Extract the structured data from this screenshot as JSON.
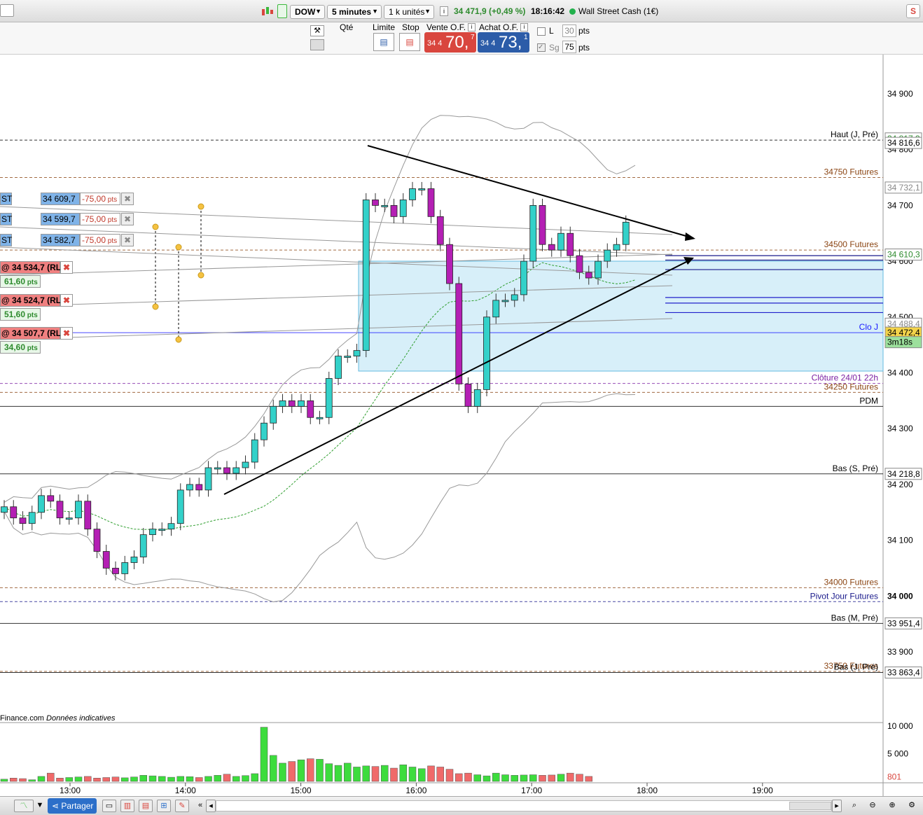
{
  "toolbar": {
    "instrument": "DOW",
    "timeframe": "5 minutes",
    "units": "1 k unités",
    "quote": "34 471,9 (+0,49 %)",
    "time": "18:16:42",
    "market_name": "Wall Street Cash (1€)",
    "status_color": "#22b14c"
  },
  "order": {
    "qty_label": "Qté",
    "limit_label": "Limite",
    "stop_label": "Stop",
    "sell_label": "Vente O.F.",
    "buy_label": "Achat O.F.",
    "sell_prefix": "34 4",
    "sell_big": "70,",
    "sell_sup": "7",
    "buy_prefix": "34 4",
    "buy_big": "73,",
    "buy_sup": "1",
    "l_label": "L",
    "l_value": "30",
    "pts1": "pts",
    "sg_label": "Sg",
    "sg_value": "75",
    "pts2": "pts",
    "sell_color": "#d9463e",
    "buy_color": "#2c5ca8"
  },
  "price_axis": {
    "ticks": [
      "34 900",
      "34 800",
      "34 700",
      "34 600",
      "34 500",
      "34 400",
      "34 300",
      "34 200",
      "34 100",
      "34 000",
      "33 900"
    ],
    "boxes": [
      {
        "text": "34 817,3",
        "color": "#2e8b2e"
      },
      {
        "text": "34 816,6",
        "color": "#000"
      },
      {
        "text": "34 732,1",
        "color": "#888"
      },
      {
        "text": "34 610,3",
        "color": "#2e8b2e"
      },
      {
        "text": "34 488,4",
        "color": "#888"
      },
      {
        "text": "34 472,4",
        "color": "#000"
      },
      {
        "text": "3m18s",
        "color": "#000"
      },
      {
        "text": "34 218,8",
        "color": "#000"
      },
      {
        "text": "33 951,4",
        "color": "#000"
      },
      {
        "text": "33 863,4",
        "color": "#000"
      }
    ]
  },
  "levels": [
    {
      "label": "34750 Futures",
      "color": "#8b4513"
    },
    {
      "label": "Haut (J, Pré)",
      "color": "#000"
    },
    {
      "label": "34500 Futures",
      "color": "#8b4513"
    },
    {
      "label": "Clo J",
      "color": "#1a1aff"
    },
    {
      "label": "Clôture 24/01 22h",
      "color": "#7b1fa2"
    },
    {
      "label": "34250 Futures",
      "color": "#8b4513"
    },
    {
      "label": "PDM",
      "color": "#000"
    },
    {
      "label": "Bas (S, Pré)",
      "color": "#000"
    },
    {
      "label": "34000 Futures",
      "color": "#8b4513"
    },
    {
      "label": "Pivot Jour Futures",
      "color": "#1a1a8b"
    },
    {
      "label": "Bas (M, Pré)",
      "color": "#000"
    },
    {
      "label": "33750 Futures",
      "color": "#8b4513"
    },
    {
      "label": "Bas (J, Pré)",
      "color": "#000"
    }
  ],
  "orders": [
    {
      "tag": "ST",
      "price": "34 609,7",
      "pts": "-75,00",
      "unit": "pts"
    },
    {
      "tag": "ST",
      "price": "34 599,7",
      "pts": "-75,00",
      "unit": "pts"
    },
    {
      "tag": "ST",
      "price": "34 582,7",
      "pts": "-75,00",
      "unit": "pts"
    }
  ],
  "positions": [
    {
      "text": "@ 34 534,7 (RL)",
      "pts": "61,60",
      "unit": "pts"
    },
    {
      "text": "@ 34 524,7 (RL)",
      "pts": "51,60",
      "unit": "pts"
    },
    {
      "text": "@ 34 507,7 (RL)",
      "pts": "34,60",
      "unit": "pts"
    }
  ],
  "footer_note": "Finance.com",
  "footer_note2": "Données indicatives",
  "volume_axis": [
    "10 000",
    "5 000",
    "801"
  ],
  "time_axis": [
    "13:00",
    "14:00",
    "15:00",
    "16:00",
    "17:00",
    "18:00",
    "19:00"
  ],
  "bottom": {
    "share_label": "Partager"
  },
  "chart_data": {
    "type": "candlestick",
    "x": [
      "12:40",
      "12:45",
      "12:50",
      "12:55",
      "13:00",
      "13:05",
      "13:10",
      "13:15",
      "13:20",
      "13:25",
      "13:30",
      "13:35",
      "13:40",
      "13:45",
      "13:50",
      "13:55",
      "14:00",
      "14:05",
      "14:10",
      "14:15",
      "14:20",
      "14:25",
      "14:30",
      "14:35",
      "14:40",
      "14:45",
      "14:50",
      "14:55",
      "15:00",
      "15:05",
      "15:10",
      "15:15",
      "15:20",
      "15:25",
      "15:30",
      "15:35",
      "15:40",
      "15:45",
      "15:50",
      "15:55",
      "16:00",
      "16:05",
      "16:10",
      "16:15",
      "16:20",
      "16:25",
      "16:30",
      "16:35",
      "16:40",
      "16:45",
      "16:50",
      "16:55",
      "17:00",
      "17:05",
      "17:10",
      "17:15",
      "17:20",
      "17:25",
      "17:30",
      "17:35",
      "17:40",
      "17:45",
      "17:50",
      "17:55",
      "18:00",
      "18:05",
      "18:10",
      "18:15"
    ],
    "open": [
      34150,
      34160,
      34140,
      34130,
      34150,
      34180,
      34170,
      34140,
      34140,
      34170,
      34120,
      34080,
      34050,
      34040,
      34060,
      34070,
      34110,
      34120,
      34120,
      34130,
      34190,
      34200,
      34190,
      34230,
      34230,
      34220,
      34230,
      34240,
      34280,
      34310,
      34340,
      34350,
      34340,
      34350,
      34320,
      34320,
      34390,
      34430,
      34430,
      34440,
      34710,
      34700,
      34700,
      34680,
      34710,
      34730,
      34730,
      34680,
      34630,
      34560,
      34380,
      34340,
      34370,
      34500,
      34530,
      34530,
      34540,
      34600,
      34700,
      34630,
      34620,
      34650,
      34610,
      34580,
      34570,
      34600,
      34620,
      34630,
      34670
    ],
    "close": [
      34160,
      34140,
      34130,
      34150,
      34180,
      34170,
      34140,
      34140,
      34170,
      34120,
      34080,
      34050,
      34040,
      34060,
      34070,
      34110,
      34120,
      34120,
      34130,
      34190,
      34200,
      34190,
      34230,
      34230,
      34220,
      34230,
      34240,
      34280,
      34310,
      34340,
      34350,
      34340,
      34350,
      34320,
      34320,
      34390,
      34430,
      34430,
      34440,
      34710,
      34700,
      34700,
      34680,
      34710,
      34730,
      34730,
      34680,
      34630,
      34560,
      34380,
      34340,
      34370,
      34500,
      34530,
      34530,
      34540,
      34600,
      34700,
      34630,
      34620,
      34650,
      34610,
      34580,
      34570,
      34600,
      34620,
      34630,
      34670,
      34660
    ],
    "volume": [
      400,
      600,
      500,
      300,
      900,
      1500,
      600,
      700,
      800,
      900,
      600,
      700,
      800,
      650,
      800,
      1100,
      1000,
      900,
      750,
      900,
      850,
      700,
      900,
      1100,
      1300,
      900,
      1050,
      1400,
      9800,
      4700,
      3300,
      3600,
      3900,
      4100,
      4000,
      3200,
      2900,
      3300,
      2600,
      2800,
      2700,
      2900,
      2400,
      3000,
      2600,
      2300,
      2800,
      2600,
      2200,
      1400,
      1500,
      1200,
      1000,
      1500,
      1200,
      1100,
      1150,
      1200,
      1100,
      1150,
      1300,
      1500,
      1300,
      900
    ]
  }
}
